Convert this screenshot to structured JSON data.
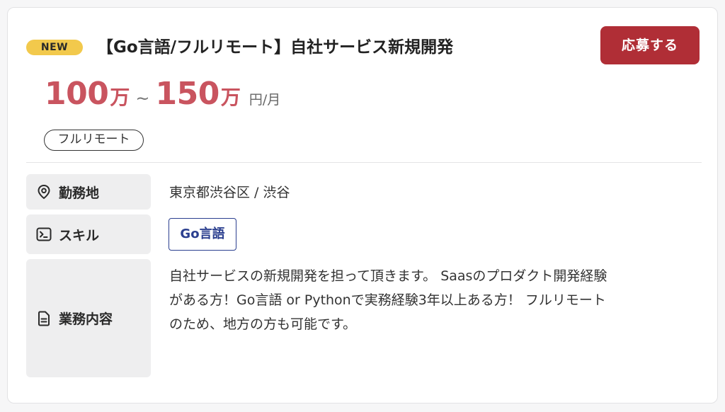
{
  "job": {
    "badge": "NEW",
    "title": "【Go言語/フルリモート】自社サービス新規開発",
    "apply_label": "応募する",
    "salary": {
      "min": "100",
      "max": "150",
      "man_unit": "万",
      "separator": "~",
      "unit": "円/月"
    },
    "tags": [
      "フルリモート"
    ],
    "details": {
      "location": {
        "label": "勤務地",
        "icon": "location-pin-icon",
        "value": "東京都渋谷区 / 渋谷"
      },
      "skills": {
        "label": "スキル",
        "icon": "terminal-icon",
        "items": [
          "Go言語"
        ]
      },
      "description": {
        "label": "業務内容",
        "icon": "document-icon",
        "lines": [
          "自社サービスの新規開発を担って頂きます。 Saasのプロダクト開発経験",
          "がある方！Go言語 or Pythonで実務経験3年以上ある方！ フルリモート",
          "のため、地方の方も可能です。"
        ]
      }
    }
  },
  "colors": {
    "badge": "#f2c94c",
    "apply_button": "#b02e36",
    "salary": "#c9545f",
    "skill_tag": "#2b3f8f",
    "label_bg": "#eeeeef"
  }
}
